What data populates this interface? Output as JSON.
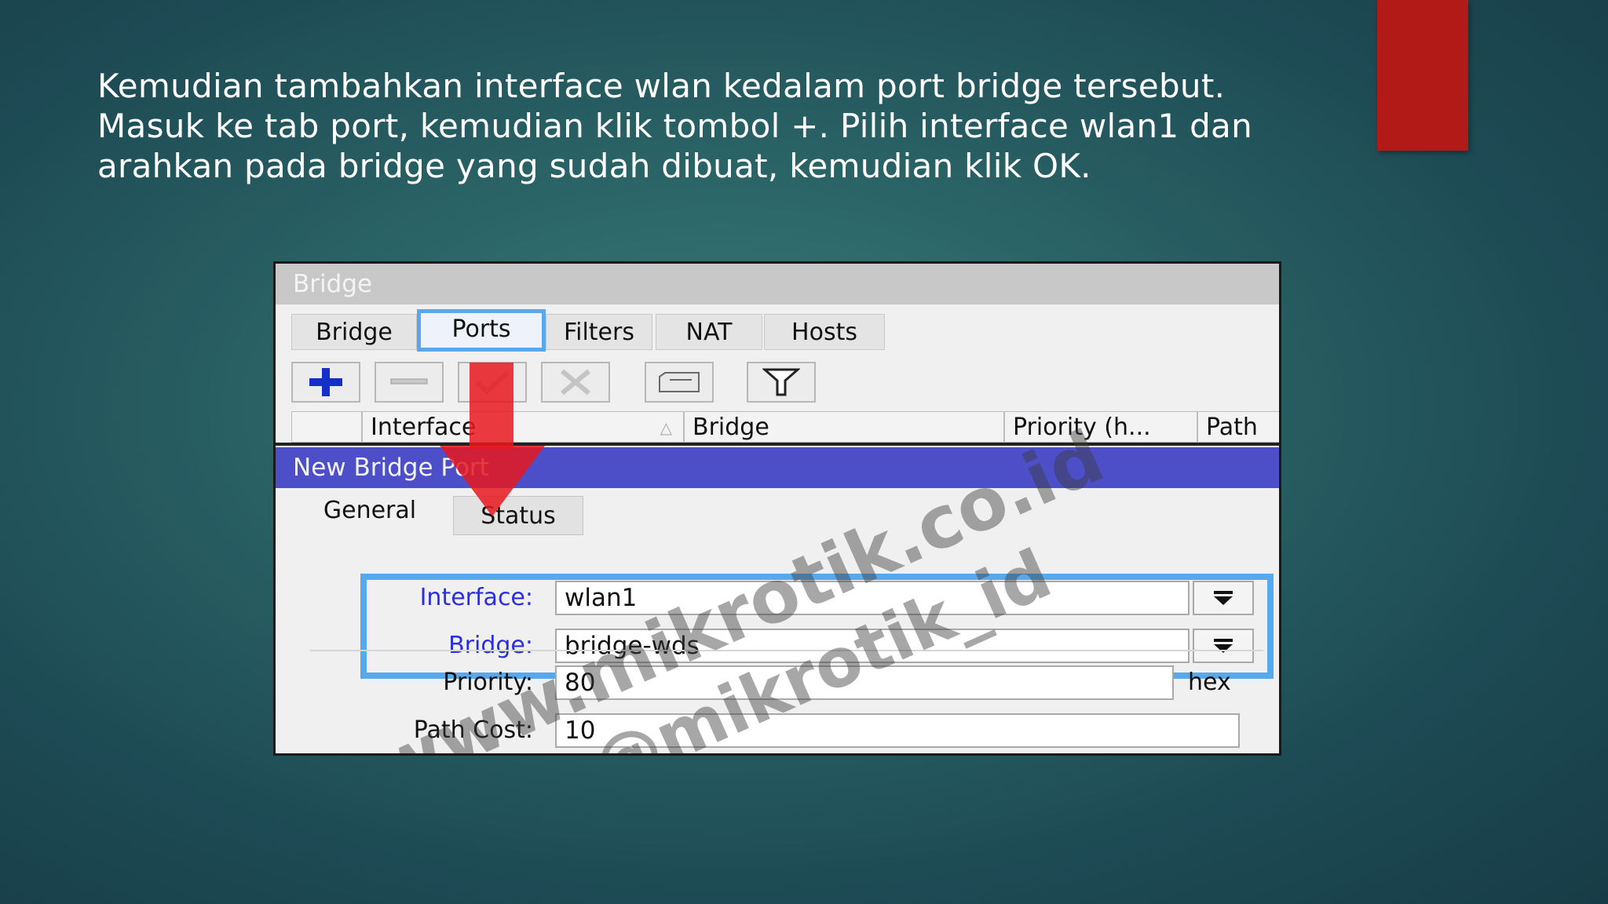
{
  "slide": {
    "lines": [
      "Kemudian tambahkan interface wlan kedalam port bridge tersebut.",
      "Masuk ke tab port, kemudian klik tombol +. Pilih interface wlan1 dan",
      "arahkan pada bridge yang sudah dibuat, kemudian klik OK."
    ],
    "accent_color": "#b21a18"
  },
  "window": {
    "title": "Bridge",
    "tabs": [
      {
        "label": "Bridge",
        "active": false
      },
      {
        "label": "Ports",
        "active": true
      },
      {
        "label": "Filters",
        "active": false
      },
      {
        "label": "NAT",
        "active": false
      },
      {
        "label": "Hosts",
        "active": false
      }
    ],
    "toolbar": [
      "add-icon",
      "remove-icon",
      "enable-check-icon",
      "disable-x-icon",
      "comment-icon",
      "filter-icon"
    ],
    "columns": [
      "",
      "Interface",
      "Bridge",
      "Priority (h...",
      "Path"
    ]
  },
  "dialog": {
    "title": "New Bridge Port",
    "tabs": [
      {
        "label": "General",
        "active": true
      },
      {
        "label": "Status",
        "active": false
      }
    ],
    "fields": {
      "interface": {
        "label": "Interface:",
        "value": "wlan1"
      },
      "bridge": {
        "label": "Bridge:",
        "value": "bridge-wds"
      },
      "priority": {
        "label": "Priority:",
        "value": "80",
        "unit": "hex"
      },
      "path_cost": {
        "label": "Path Cost:",
        "value": "10"
      }
    },
    "highlight_color": "#57a9ee",
    "title_bar_color": "#4c4fc8"
  },
  "watermarks": [
    "www.mikrotik.co.id",
    "@mikrotik_id"
  ]
}
